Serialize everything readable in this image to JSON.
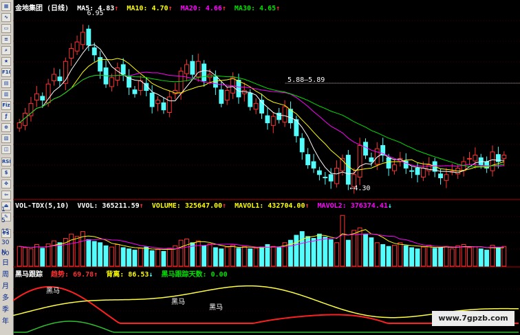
{
  "toolbar": {
    "icons": [
      "grid-icon",
      "line-chart-icon",
      "window-icon",
      "list-icon",
      "search-icon",
      "star-icon",
      "f10-icon",
      "indicator-icon",
      "chart-icon",
      "fiz-icon",
      "formula-icon",
      "zoom-icon",
      "bar-icon",
      "layer-icon",
      "rsi-icon",
      "dollar-icon",
      "move-icon",
      "move-left-icon",
      "exit-icon",
      "draw-icon",
      "fs-icon"
    ],
    "f10_label": "F10",
    "fiz_label": "Fiz",
    "rsi_label": "RSI",
    "fs_label": "Fs",
    "numbers": [
      "1",
      "5",
      "15",
      "30",
      "60"
    ],
    "period_n": "N",
    "periods": [
      "日",
      "周",
      "月",
      "多",
      "季",
      "年"
    ]
  },
  "price_panel": {
    "title": "金地集团 (日线)",
    "ma5": "MA5: 4.83",
    "ma5_arrow": "↑",
    "ma10": "MA10: 4.70",
    "ma10_arrow": "↑",
    "ma20": "MA20: 4.66",
    "ma20_arrow": "↑",
    "ma30": "MA30: 4.65",
    "ma30_arrow": "↑",
    "high_label": "6.95",
    "mid_label": "5.88—5.89",
    "low_label": "←4.30"
  },
  "vol_panel": {
    "name": "VOL-TDX(5,10)",
    "vvol": "VVOL: 365211.59",
    "vvol_arrow": "↑",
    "volume": "VOLUME: 325647.00",
    "volume_arrow": "↑",
    "mavol1": "MAVOL1: 432704.00",
    "mavol1_arrow": "↑",
    "mavol2": "MAVOL2: 376374.41",
    "mavol2_arrow": "↓"
  },
  "ind_panel": {
    "name": "黑马跟踪",
    "trend": "趋势: 69.78",
    "trend_arrow": "↑",
    "back_high": "背离: 86.53",
    "back_high_arrow": "↓",
    "days": "黑马跟踪天数: 0.00",
    "marker_label": "黑马",
    "markers": [
      "黑马",
      "黑马",
      "黑马"
    ]
  },
  "watermark": "www.7gpzb.com",
  "colors": {
    "up": "#ff3232",
    "down": "#54fcfc",
    "ma5": "#ffffff",
    "ma10": "#ffff00",
    "ma20": "#ff00ff",
    "ma30": "#00e000",
    "red_line": "#ff2020",
    "yellow_line": "#ffff40",
    "green_line": "#30c030"
  },
  "chart_data": {
    "type": "candlestick",
    "price_closes": [
      5.3,
      5.45,
      5.6,
      5.75,
      5.65,
      5.9,
      6.05,
      5.95,
      6.25,
      6.45,
      6.55,
      6.7,
      6.5,
      6.35,
      6.1,
      5.9,
      6.0,
      6.15,
      6.05,
      5.85,
      5.75,
      5.95,
      5.8,
      5.55,
      5.65,
      5.5,
      5.7,
      5.8,
      6.1,
      6.2,
      6.05,
      6.25,
      5.95,
      6.05,
      5.85,
      5.6,
      5.8,
      6.0,
      5.7,
      5.8,
      5.55,
      5.6,
      5.45,
      5.3,
      5.4,
      5.35,
      5.55,
      5.3,
      5.1,
      4.85,
      4.65,
      4.6,
      4.5,
      4.45,
      4.4,
      4.6,
      4.75,
      4.35,
      4.5,
      4.95,
      4.8,
      4.7,
      4.9,
      4.8,
      4.6,
      4.65,
      4.75,
      4.6,
      4.55,
      4.5,
      4.6,
      4.65,
      4.55,
      4.45,
      4.5,
      4.55,
      4.6,
      4.7,
      4.75,
      4.8,
      4.65,
      4.6,
      4.85,
      4.7,
      4.8
    ],
    "volumes": [
      320,
      300,
      280,
      350,
      290,
      360,
      410,
      380,
      450,
      520,
      480,
      560,
      430,
      400,
      380,
      330,
      310,
      350,
      300,
      280,
      260,
      290,
      310,
      250,
      270,
      240,
      290,
      330,
      420,
      440,
      380,
      410,
      330,
      360,
      300,
      280,
      310,
      340,
      290,
      320,
      280,
      290,
      310,
      350,
      320,
      300,
      380,
      420,
      500,
      560,
      480,
      450,
      520,
      470,
      430,
      380,
      820,
      420,
      580,
      620,
      520,
      460,
      380,
      350,
      320,
      340,
      380,
      330,
      300,
      280,
      310,
      340,
      290,
      300,
      320,
      280,
      330,
      350,
      300,
      310,
      280,
      260,
      340,
      300,
      320
    ],
    "ma_lines": [
      "MA5",
      "MA10",
      "MA20",
      "MA30"
    ],
    "price_high": 6.95,
    "price_low": 4.3
  }
}
